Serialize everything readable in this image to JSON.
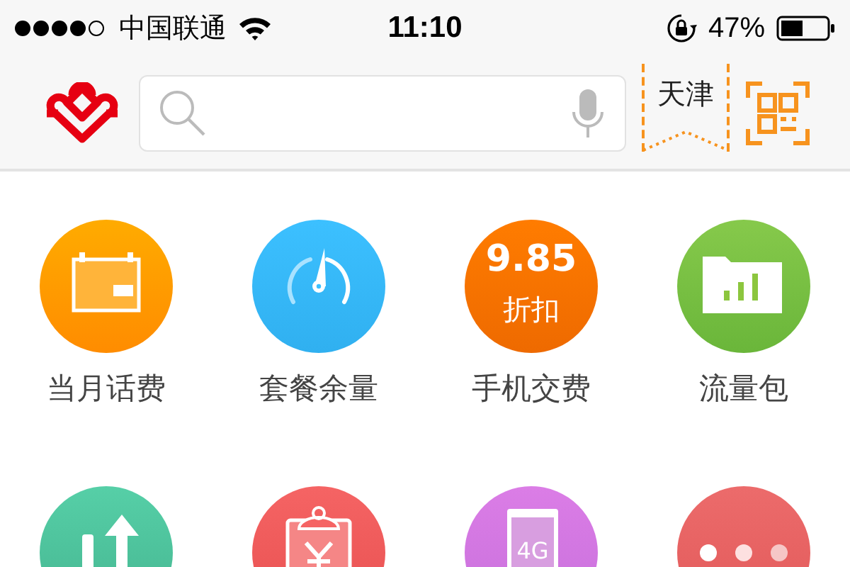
{
  "status_bar": {
    "carrier": "中国联通",
    "time": "11:10",
    "battery_text": "47%"
  },
  "header": {
    "city": "天津"
  },
  "services": [
    {
      "kind": "calendar",
      "label": "当月话费"
    },
    {
      "kind": "gauge",
      "label": "套餐余量"
    },
    {
      "kind": "discount",
      "label": "手机交费",
      "icon_text": [
        "9.85",
        "折扣"
      ]
    },
    {
      "kind": "folder",
      "label": "流量包"
    },
    {
      "kind": "transfer"
    },
    {
      "kind": "bill"
    },
    {
      "kind": "phone",
      "icon_text": [
        "4G"
      ]
    },
    {
      "kind": "more"
    }
  ]
}
